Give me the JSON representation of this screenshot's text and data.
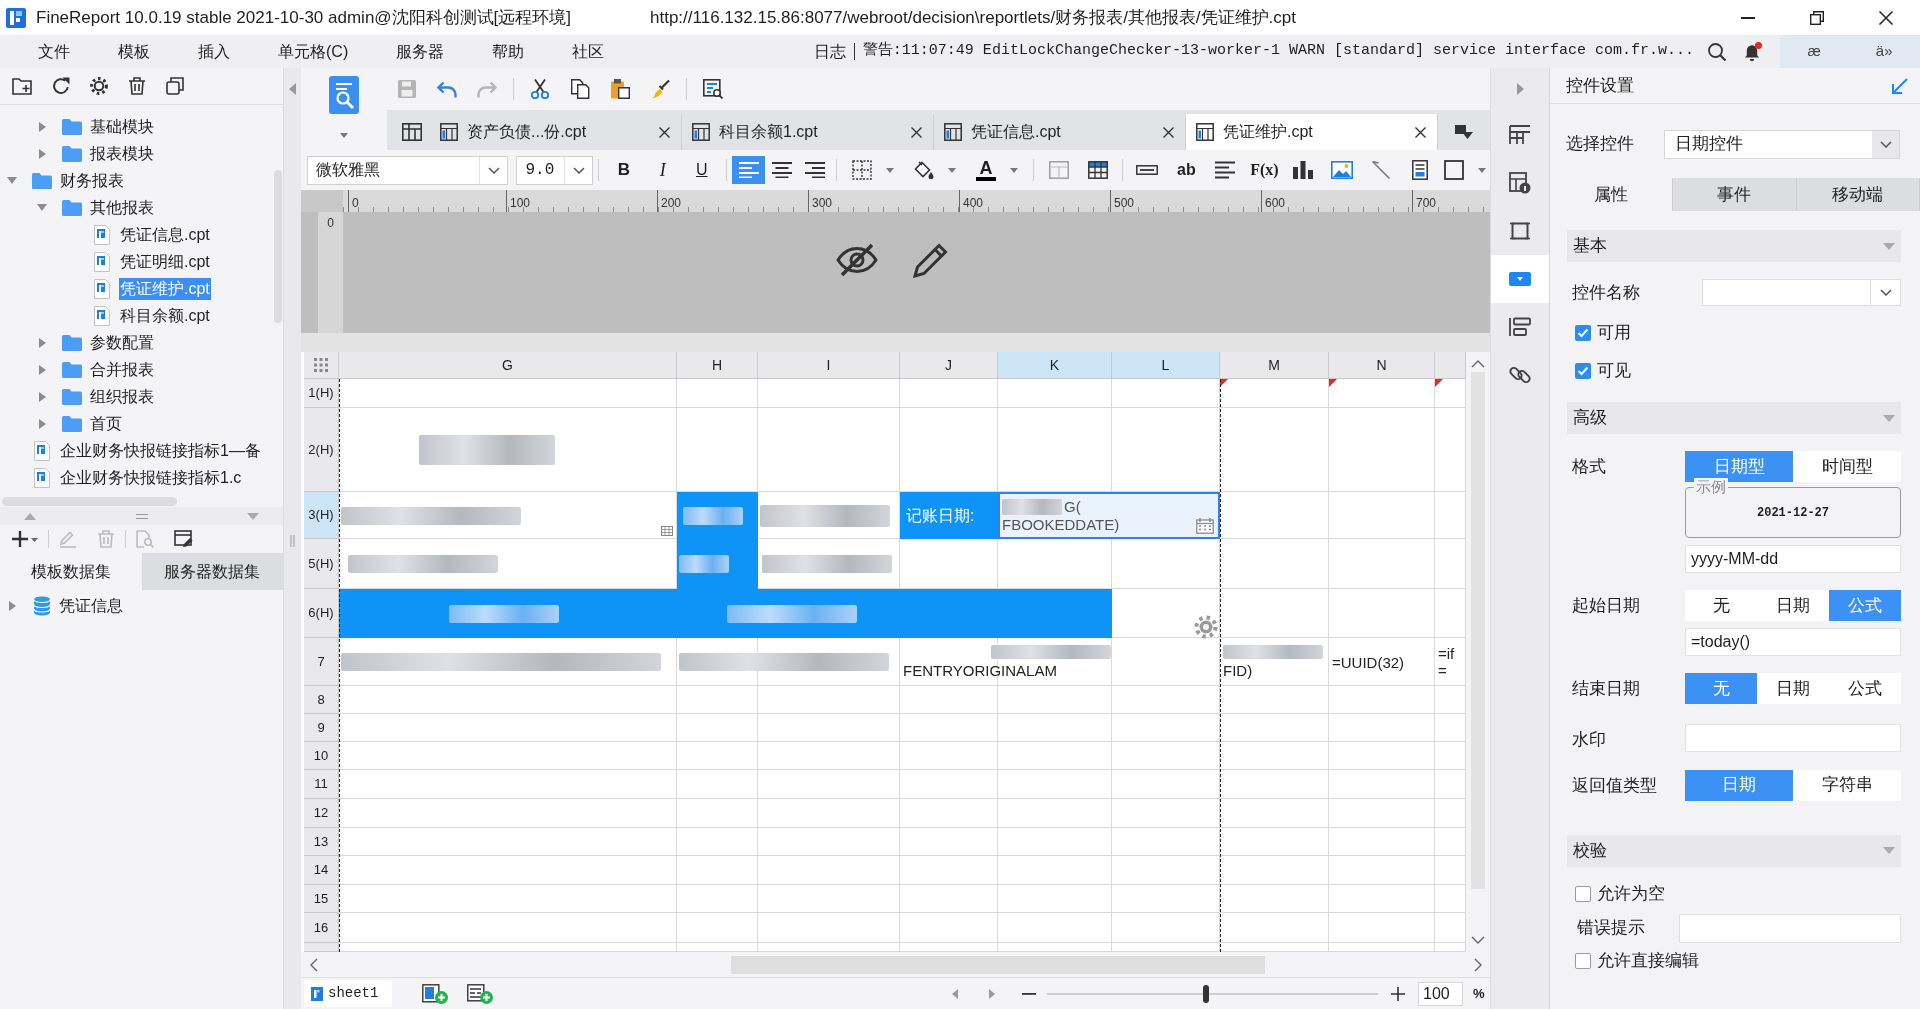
{
  "window": {
    "title": "FineReport 10.0.19 stable 2021-10-30 admin@沈阳科创测试[远程环境]",
    "path": "http://116.132.15.86:8077/webroot/decision\\reportlets/财务报表/其他报表/凭证维护.cpt"
  },
  "menu": [
    "文件",
    "模板",
    "插入",
    "单元格(C)",
    "服务器",
    "帮助",
    "社区"
  ],
  "log": {
    "label": "日志",
    "message": "警告:11:07:49 EditLockChangeChecker-13-worker-1 WARN [standard] service interface com.fr.w...",
    "notification": true
  },
  "tray": [
    "æ",
    "ä»"
  ],
  "file_tree": {
    "tools": [
      {
        "kind": "new-folder"
      },
      {
        "kind": "refresh"
      },
      {
        "kind": "settings"
      },
      {
        "kind": "delete"
      },
      {
        "kind": "copy"
      }
    ],
    "items": [
      {
        "children": [
          {
            "label": "基础模块",
            "kind": "folder",
            "expanded": false,
            "selected": false
          },
          {
            "label": "报表模块",
            "kind": "folder",
            "expanded": false,
            "selected": false
          }
        ]
      },
      {
        "label": "财务报表",
        "kind": "folder",
        "expanded": true,
        "selected": false,
        "children": [
          {
            "label": "其他报表",
            "kind": "folder",
            "expanded": true,
            "selected": false,
            "children": [
              {
                "label": "凭证信息.cpt",
                "kind": "file",
                "selected": false
              },
              {
                "label": "凭证明细.cpt",
                "kind": "file",
                "selected": false
              },
              {
                "label": "凭证维护.cpt",
                "kind": "file",
                "selected": true
              },
              {
                "label": "科目余额.cpt",
                "kind": "file",
                "selected": false
              }
            ]
          },
          {
            "label": "参数配置",
            "kind": "folder",
            "expanded": false,
            "selected": false
          },
          {
            "label": "合并报表",
            "kind": "folder",
            "expanded": false,
            "selected": false
          },
          {
            "label": "组织报表",
            "kind": "folder",
            "expanded": false,
            "selected": false
          },
          {
            "label": "首页",
            "kind": "folder",
            "expanded": false,
            "selected": false
          }
        ]
      },
      {
        "label": "企业财务快报链接指标1—备",
        "kind": "file",
        "selected": false
      },
      {
        "label": "企业财务快报链接指标1.c",
        "kind": "file",
        "selected": false
      }
    ]
  },
  "datasets": {
    "tools": [
      [
        {
          "kind": "add",
          "disabled": false
        }
      ],
      [
        {
          "kind": "edit",
          "disabled": true
        },
        {
          "kind": "delete",
          "disabled": true
        }
      ],
      [
        {
          "kind": "preview",
          "disabled": true
        },
        {
          "kind": "query",
          "disabled": false
        }
      ]
    ],
    "tabs": [
      {
        "label": "模板数据集",
        "selected": true
      },
      {
        "label": "服务器数据集",
        "selected": false
      }
    ],
    "items": [
      {
        "label": "凭证信息",
        "expanded": false,
        "selected": false
      }
    ]
  },
  "toolbar": [
    [
      {
        "kind": "save",
        "disabled": true
      },
      {
        "kind": "undo",
        "disabled": false
      },
      {
        "kind": "redo",
        "disabled": true
      }
    ],
    [
      {
        "kind": "cut",
        "disabled": false
      },
      {
        "kind": "copy",
        "disabled": false
      },
      {
        "kind": "paste",
        "disabled": false
      },
      {
        "kind": "painter",
        "disabled": false
      }
    ],
    [
      {
        "kind": "preview",
        "disabled": false
      }
    ]
  ],
  "tabs": [
    {
      "label": "资产负债...份.cpt",
      "selected": false
    },
    {
      "label": "科目余额1.cpt",
      "selected": false
    },
    {
      "label": "凭证信息.cpt",
      "selected": false
    },
    {
      "label": "凭证维护.cpt",
      "selected": true
    }
  ],
  "format_bar": {
    "font": "微软雅黑",
    "size": "9.0",
    "groups": [
      [
        {
          "kind": "bold",
          "text": "B"
        },
        {
          "kind": "italic",
          "text": "I"
        },
        {
          "kind": "underline",
          "text": "U"
        }
      ],
      [
        {
          "kind": "align-left",
          "selected": true
        },
        {
          "kind": "align-center",
          "selected": false
        },
        {
          "kind": "align-right",
          "selected": false
        }
      ],
      [
        {
          "kind": "border"
        },
        {
          "kind": "fill"
        },
        {
          "kind": "font-color",
          "text": "A",
          "color": "#000000"
        }
      ],
      [
        {
          "kind": "merge"
        },
        {
          "kind": "table"
        }
      ],
      [
        {
          "kind": "text-field"
        },
        {
          "kind": "text",
          "text": "ab"
        },
        {
          "kind": "paragraph"
        },
        {
          "kind": "formula",
          "text": "F(x)"
        },
        {
          "kind": "chart"
        },
        {
          "kind": "image"
        },
        {
          "kind": "slash"
        },
        {
          "kind": "sub-report"
        },
        {
          "kind": "cell-border"
        }
      ]
    ]
  },
  "ruler": {
    "marks": [
      "0",
      "100",
      "200",
      "300",
      "400",
      "500",
      "600",
      "700"
    ],
    "side_marks": [
      "0"
    ]
  },
  "sheet": {
    "columns": [
      {
        "label": "G",
        "selected": false
      },
      {
        "label": "H",
        "selected": false
      },
      {
        "label": "I",
        "selected": false
      },
      {
        "label": "J",
        "selected": false
      },
      {
        "label": "K",
        "selected": true
      },
      {
        "label": "L",
        "selected": true
      },
      {
        "label": "M",
        "selected": false
      },
      {
        "label": "N",
        "selected": false
      },
      {
        "selected": false
      }
    ],
    "rows": [
      {
        "label": "1(H)",
        "selected": false,
        "cells": [
          {
            "kind": "empty"
          },
          {
            "kind": "empty"
          },
          {
            "kind": "empty"
          },
          {
            "kind": "empty"
          },
          {
            "kind": "empty"
          },
          {
            "kind": "empty"
          },
          {
            "kind": "flag"
          },
          {
            "kind": "flag"
          },
          {
            "kind": "flag"
          }
        ]
      },
      {
        "label": "2(H)",
        "selected": false,
        "cells": [
          {
            "kind": "blurred",
            "filled": false
          }
        ]
      },
      {
        "label": "3(H)",
        "selected": true,
        "cells": [
          {
            "kind": "blurred",
            "filled": false,
            "widget": true
          },
          {
            "kind": "blurred",
            "filled": true
          },
          {
            "kind": "blurred",
            "filled": false
          },
          {
            "kind": "text",
            "filled": true,
            "blurred": false,
            "lines": [
              "记账日期:"
            ]
          },
          {
            "kind": "date-editor",
            "selected": true,
            "blurred": true,
            "lines": [
              "G(",
              "FBOOKEDDATE)"
            ]
          },
          {
            "kind": "merged"
          }
        ]
      },
      {
        "label": "5(H)",
        "selected": false,
        "cells": [
          {
            "kind": "blurred",
            "filled": false
          },
          {
            "kind": "blurred",
            "filled": true
          },
          {
            "kind": "blurred",
            "filled": false
          }
        ]
      },
      {
        "label": "6(H)",
        "selected": false,
        "cells": [
          {
            "kind": "blurred",
            "filled": true
          },
          {
            "kind": "blurred",
            "filled": true
          },
          {
            "kind": "merged"
          },
          {
            "kind": "merged"
          },
          {
            "kind": "merged"
          }
        ]
      },
      {
        "label": "7",
        "selected": false,
        "cells": [
          {
            "kind": "blurred",
            "filled": false
          },
          {
            "kind": "blurred",
            "filled": false
          },
          {
            "kind": "merged"
          },
          {
            "kind": "text",
            "filled": false,
            "blurred": true,
            "lines": [
              "FENTRYORIGINALAM"
            ]
          },
          {
            "kind": "merged"
          },
          {
            "kind": "empty"
          },
          {
            "kind": "text",
            "filled": false,
            "blurred": true,
            "lines": [
              "FID)"
            ]
          },
          {
            "kind": "text",
            "filled": false,
            "blurred": false,
            "lines": [
              "=UUID(32)"
            ]
          },
          {
            "kind": "text",
            "filled": false,
            "blurred": false,
            "lines": [
              "=if",
              "="
            ]
          }
        ]
      },
      {
        "label": "8",
        "selected": false
      },
      {
        "label": "9",
        "selected": false
      },
      {
        "label": "10",
        "selected": false
      },
      {
        "label": "11",
        "selected": false
      },
      {
        "label": "12",
        "selected": false
      },
      {
        "label": "13",
        "selected": false
      },
      {
        "label": "14",
        "selected": false
      },
      {
        "label": "15",
        "selected": false
      },
      {
        "label": "16",
        "selected": false
      },
      {
        "selected": false
      }
    ]
  },
  "side_tools": [
    {
      "kind": "cell",
      "selected": false
    },
    {
      "kind": "element",
      "selected": false
    },
    {
      "kind": "frame",
      "selected": false
    },
    {
      "kind": "widget",
      "selected": true
    },
    {
      "kind": "condition",
      "selected": false
    },
    {
      "kind": "link",
      "selected": false
    }
  ],
  "sheet_tabs": [
    {
      "label": "sheet1",
      "selected": true
    }
  ],
  "zoom": {
    "level": 0.48,
    "value": "100",
    "unit": "%"
  },
  "widget_settings": {
    "title": "控件设置",
    "select_label": "选择控件",
    "select_value": "日期控件",
    "tabs": [
      {
        "label": "属性",
        "selected": true
      },
      {
        "label": "事件",
        "selected": false
      },
      {
        "label": "移动端",
        "selected": false
      }
    ],
    "basic": {
      "title": "基本",
      "name_label": "控件名称",
      "checks": [
        {
          "label": "可用",
          "checked": true
        },
        {
          "label": "可见",
          "checked": true
        }
      ]
    },
    "advanced": {
      "title": "高级",
      "rows": [
        {
          "kind": "segmented",
          "label": "格式",
          "options": [
            {
              "label": "日期型",
              "selected": true
            },
            {
              "label": "时间型",
              "selected": false
            }
          ]
        },
        {
          "kind": "example",
          "legend": "示例",
          "value": "2021-12-27"
        },
        {
          "kind": "input",
          "value": "yyyy-MM-dd"
        },
        {
          "kind": "segmented",
          "label": "起始日期",
          "options": [
            {
              "label": "无",
              "selected": false
            },
            {
              "label": "日期",
              "selected": false
            },
            {
              "label": "公式",
              "selected": true
            }
          ]
        },
        {
          "kind": "input",
          "value": "=today()"
        },
        {
          "kind": "segmented",
          "label": "结束日期",
          "options": [
            {
              "label": "无",
              "selected": true
            },
            {
              "label": "日期",
              "selected": false
            },
            {
              "label": "公式",
              "selected": false
            }
          ]
        },
        {
          "kind": "input",
          "label": "水印"
        },
        {
          "kind": "segmented",
          "label": "返回值类型",
          "options": [
            {
              "label": "日期",
              "selected": true
            },
            {
              "label": "字符串",
              "selected": false
            }
          ]
        }
      ]
    },
    "validation": {
      "title": "校验",
      "rows": [
        {
          "kind": "check",
          "label": "允许为空",
          "checked": false
        },
        {
          "kind": "input",
          "label": "错误提示"
        },
        {
          "kind": "check",
          "label": "允许直接编辑",
          "checked": false
        }
      ]
    }
  }
}
